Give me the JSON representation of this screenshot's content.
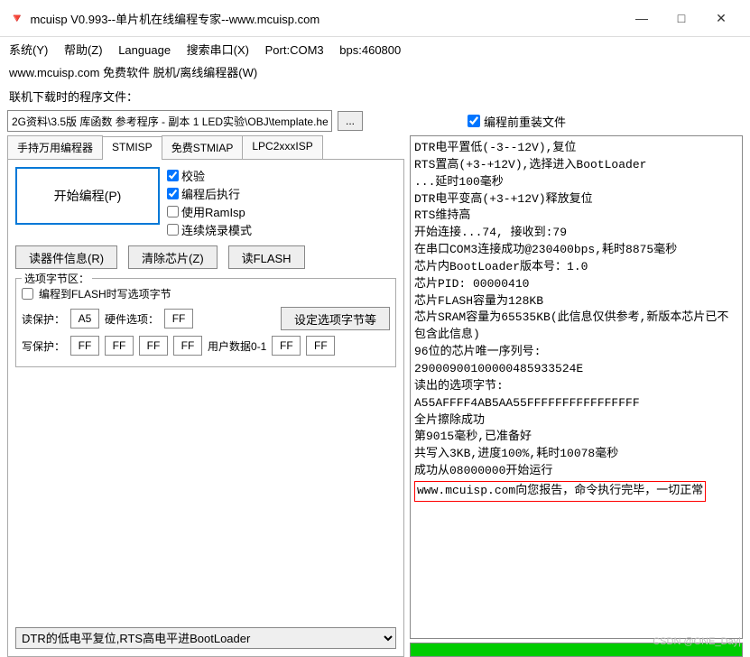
{
  "window": {
    "title": "mcuisp V0.993--单片机在线编程专家--www.mcuisp.com",
    "controls": {
      "min": "—",
      "max": "□",
      "close": "✕"
    }
  },
  "menu": {
    "system": "系统(Y)",
    "help": "帮助(Z)",
    "language": "Language",
    "search_port": "搜索串口(X)",
    "port": "Port:COM3",
    "bps": "bps:460800"
  },
  "subline": "www.mcuisp.com 免费软件 脱机/离线编程器(W)",
  "file_label": "联机下载时的程序文件：",
  "file_path": "2G资料\\3.5版 库函数 参考程序 - 副本 1 LED实验\\OBJ\\template.hex",
  "browse": "...",
  "reload_checkbox": "编程前重装文件",
  "tabs": [
    "手持万用编程器",
    "STMISP",
    "免费STMIAP",
    "LPC2xxxISP"
  ],
  "program_button": "开始编程(P)",
  "checks": {
    "verify": "校验",
    "run_after": "编程后执行",
    "use_ramisp": "使用RamIsp",
    "continuous": "连续烧录模式"
  },
  "buttons": {
    "reader_info": "读器件信息(R)",
    "erase_chip": "清除芯片(Z)",
    "read_flash": "读FLASH"
  },
  "option_group": "选项字节区：",
  "flash_option_chk": "编程到FLASH时写选项字节",
  "labels": {
    "read_protect": "读保护：",
    "hw_option": "硬件选项：",
    "set_option": "设定选项字节等",
    "write_protect": "写保护：",
    "user_data": "用户数据0-1"
  },
  "values": {
    "rp": "A5",
    "hw": "FF",
    "wp0": "FF",
    "wp1": "FF",
    "wp2": "FF",
    "wp3": "FF",
    "ud0": "FF",
    "ud1": "FF"
  },
  "combo": "DTR的低电平复位,RTS高电平进BootLoader",
  "log_lines": [
    "DTR电平置低(-3--12V),复位",
    "RTS置高(+3-+12V),选择进入BootLoader",
    "...延时100毫秒",
    "DTR电平变高(+3-+12V)释放复位",
    "RTS维持高",
    "开始连接...74, 接收到:79",
    "在串口COM3连接成功@230400bps,耗时8875毫秒",
    "芯片内BootLoader版本号：1.0",
    "芯片PID: 00000410",
    "芯片FLASH容量为128KB",
    "芯片SRAM容量为65535KB(此信息仅供参考,新版本芯片已不包含此信息)",
    "96位的芯片唯一序列号:",
    "29000900100000485933524E",
    "读出的选项字节:",
    "A55AFFFF4AB5AA55FFFFFFFFFFFFFFFF",
    "全片擦除成功",
    "第9015毫秒,已准备好",
    "共写入3KB,进度100%,耗时10078毫秒",
    "成功从08000000开始运行"
  ],
  "log_final": "www.mcuisp.com向您报告，命令执行完毕，一切正常",
  "watermark": "CSDN @ONE_Day|"
}
